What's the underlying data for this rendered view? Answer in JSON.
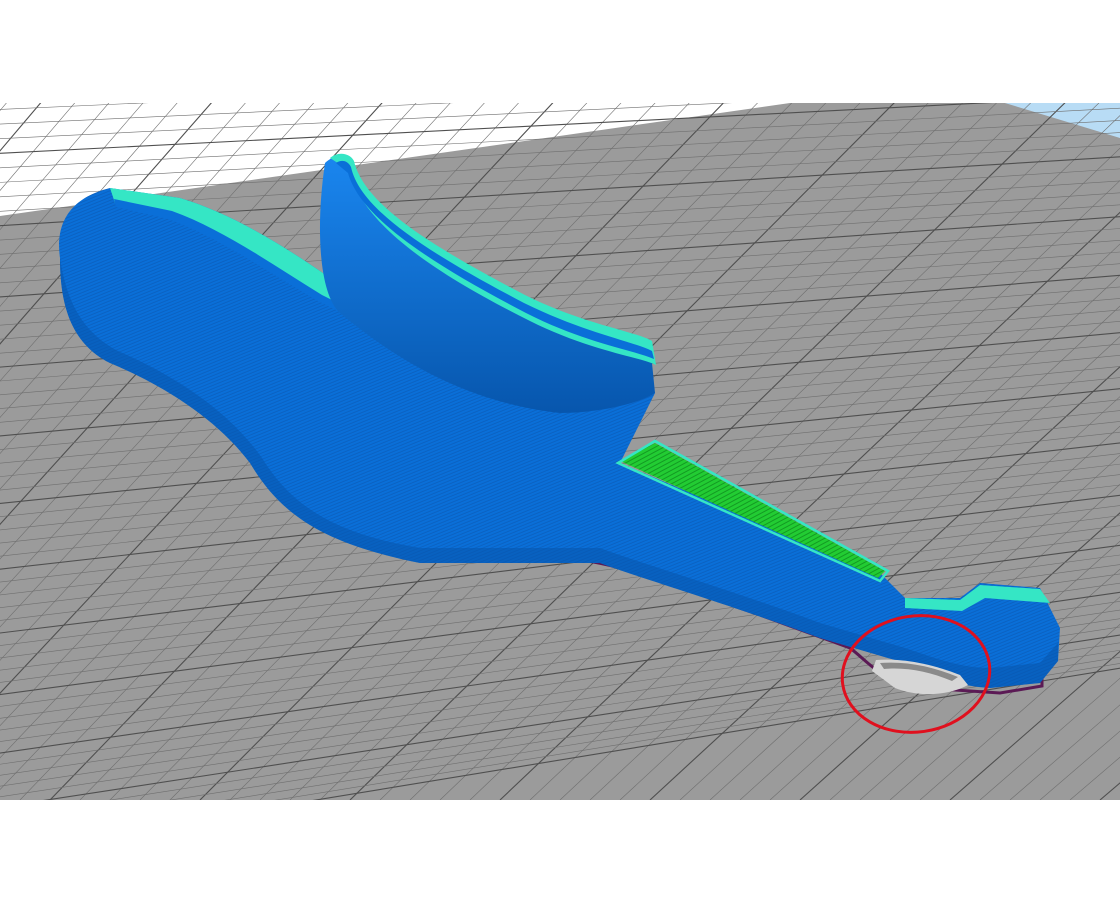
{
  "viewport": {
    "sky_color": "#b8dcf5",
    "bed_color": "#9b9b9b",
    "grid_line_color": "#6f6f6f",
    "grid_major_color": "#4f4f4f",
    "model_color": "#0a6fd8",
    "model_shadow_color": "#0756ad",
    "perimeter_color": "#35e6c5",
    "infill_color": "#22cc33",
    "skirt_color": "#5b1a55",
    "support_color": "#d6d6d6",
    "highlight_color": "#e0101e"
  },
  "objects": [
    {
      "label": "printed-part",
      "type": "toolpath-preview"
    },
    {
      "label": "support-structure",
      "type": "support-preview"
    },
    {
      "label": "problem-highlight",
      "type": "annotation-circle"
    }
  ]
}
